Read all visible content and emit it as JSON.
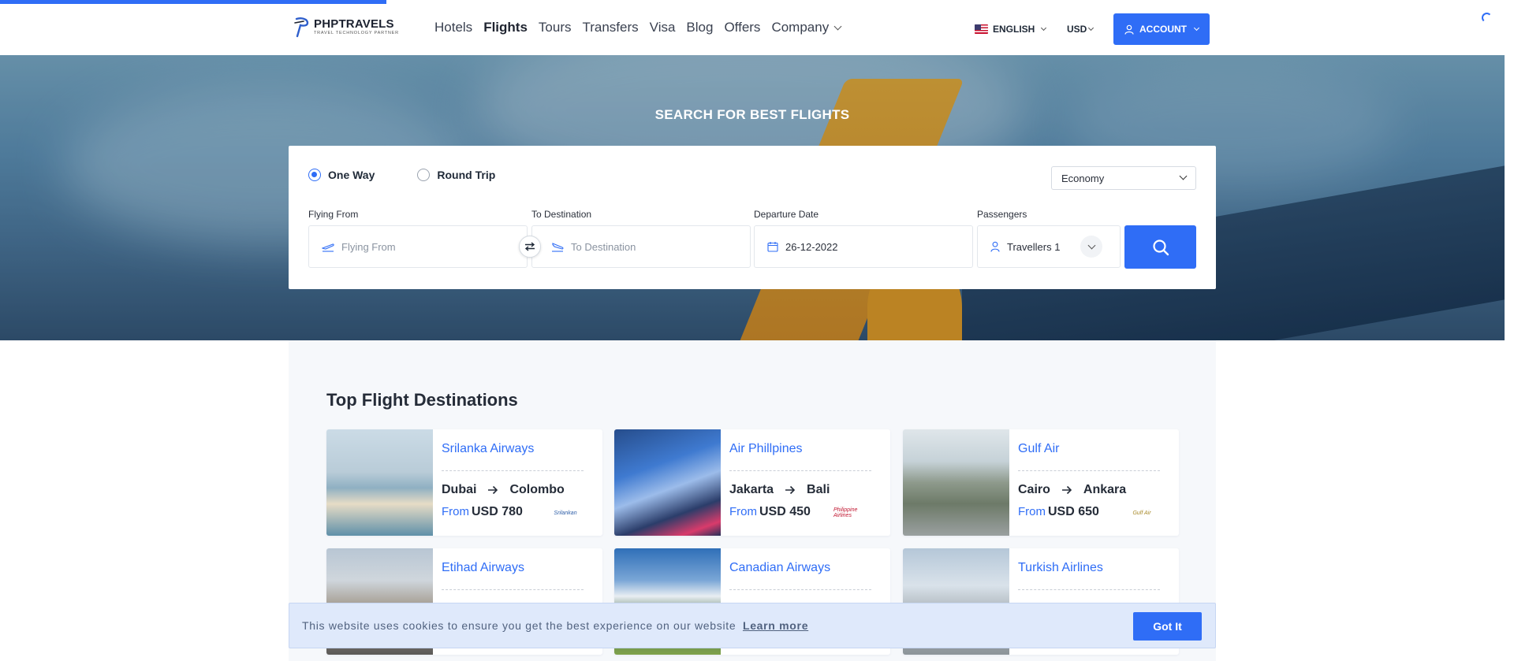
{
  "header": {
    "brand_name": "PHPTRAVELS",
    "brand_tagline": "TRAVEL TECHNOLOGY PARTNER",
    "nav": [
      "Hotels",
      "Flights",
      "Tours",
      "Transfers",
      "Visa",
      "Blog",
      "Offers",
      "Company"
    ],
    "active_nav": "Flights",
    "language": "ENGLISH",
    "currency": "USD",
    "account": "ACCOUNT"
  },
  "hero": {
    "title": "SEARCH FOR BEST FLIGHTS"
  },
  "search": {
    "trip_types": [
      "One Way",
      "Round Trip"
    ],
    "selected_trip": "One Way",
    "cabin_class": "Economy",
    "flying_from_label": "Flying From",
    "flying_from_placeholder": "Flying From",
    "to_label": "To Destination",
    "to_placeholder": "To Destination",
    "date_label": "Departure Date",
    "date_value": "26-12-2022",
    "passengers_label": "Passengers",
    "passengers_value": "Travellers 1"
  },
  "destinations": {
    "title": "Top Flight Destinations",
    "from_label": "From",
    "cards": [
      {
        "airline": "Srilanka Airways",
        "from": "Dubai",
        "to": "Colombo",
        "price": "USD 780",
        "logo": "Srilankan"
      },
      {
        "airline": "Air Phillpines",
        "from": "Jakarta",
        "to": "Bali",
        "price": "USD 450",
        "logo": "Philippine Airlines"
      },
      {
        "airline": "Gulf Air",
        "from": "Cairo",
        "to": "Ankara",
        "price": "USD 650",
        "logo": "Gulf Air"
      },
      {
        "airline": "Etihad Airways"
      },
      {
        "airline": "Canadian Airways"
      },
      {
        "airline": "Turkish Airlines"
      }
    ]
  },
  "cookie": {
    "text": "This website uses cookies to ensure you get the best experience on our website",
    "link": "Learn more",
    "button": "Got It"
  },
  "colors": {
    "primary": "#2f6df6",
    "heading": "#252c38",
    "section_bg": "#f6f8fb",
    "cookie_bg": "#dfe9fb"
  }
}
